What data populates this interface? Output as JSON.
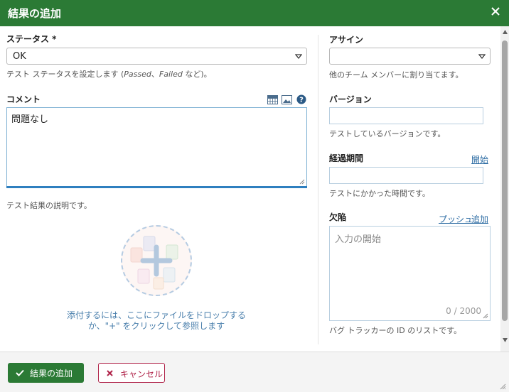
{
  "dialog": {
    "title": "結果の追加",
    "close_icon": "close-icon"
  },
  "status": {
    "label": "ステータス *",
    "value": "OK",
    "hint_prefix": "テスト ステータスを設定します (",
    "hint_passed": "Passed",
    "hint_sep": "、",
    "hint_failed": "Failed",
    "hint_suffix": " など)。"
  },
  "comment": {
    "label": "コメント",
    "value": "問題なし",
    "hint": "テスト結果の説明です。",
    "toolbar_icons": [
      "table-icon",
      "image-icon",
      "help-icon"
    ]
  },
  "attachments": {
    "line1": "添付するには、ここにファイルをドロップする",
    "line2": "か、\"+\" をクリックして参照します"
  },
  "assign": {
    "label": "アサイン",
    "value": "",
    "hint": "他のチーム メンバーに割り当てます。"
  },
  "version": {
    "label": "バージョン",
    "value": "",
    "hint": "テストしているバージョンです。"
  },
  "elapsed": {
    "label": "経過期間",
    "start_link": "開始",
    "value": "",
    "hint": "テストにかかった時間です。"
  },
  "defects": {
    "label": "欠陥",
    "push_link": "プッシュ",
    "add_link": "追加",
    "placeholder": "入力の開始",
    "counter": "0 / 2000",
    "hint": "バグ トラッカーの ID のリストです。"
  },
  "footer": {
    "submit_label": "結果の追加",
    "cancel_label": "キャンセル"
  },
  "colors": {
    "header": "#2b7a35",
    "primary_button": "#2b7a35",
    "cancel_accent": "#b0244a",
    "link": "#2e6da4"
  }
}
